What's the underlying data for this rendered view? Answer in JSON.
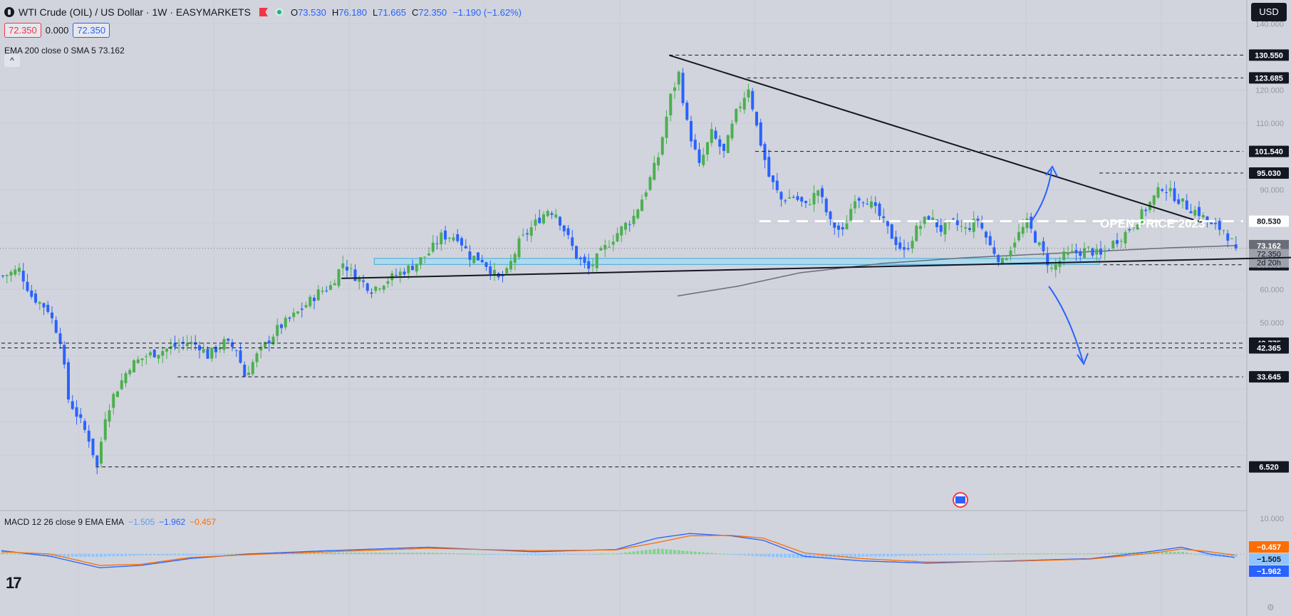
{
  "header": {
    "title": "WTI Crude (OIL) / US Dollar · 1W · EASYMARKETS",
    "ohlc": {
      "o_label": "O",
      "o": "73.530",
      "h_label": "H",
      "h": "76.180",
      "l_label": "L",
      "l": "71.665",
      "c_label": "C",
      "c": "72.350",
      "change": "−1.190 (−1.62%)"
    },
    "sell_price": "72.350",
    "spread": "0.000",
    "buy_price": "72.350",
    "indicator": "EMA 200 close 0 SMA 5  73.162",
    "collapse_icon": "^",
    "currency": "USD"
  },
  "macd": {
    "label": "MACD 12 26 close 9 EMA EMA",
    "v1": "−1.505",
    "v2": "−1.962",
    "v3": "−0.457"
  },
  "colors": {
    "bg": "#d1d4dc",
    "up": "#4caf50",
    "down": "#2962ff",
    "zone": "#a9dcf2",
    "ema": "#6a6d78",
    "macd": "#2962ff",
    "signal": "#ff6d00"
  },
  "chart_data": {
    "type": "candlestick",
    "timeframe": "1W",
    "price_axis_ticks": [
      "140.000",
      "120.000",
      "110.000",
      "90.000",
      "80.000",
      "60.000",
      "50.000"
    ],
    "ylim": [
      -3,
      145
    ],
    "levels": [
      {
        "value": 130.55,
        "label": "130.550"
      },
      {
        "value": 123.685,
        "label": "123.685"
      },
      {
        "value": 101.54,
        "label": "101.540"
      },
      {
        "value": 95.03,
        "label": "95.030"
      },
      {
        "value": 80.53,
        "label": "80.530"
      },
      {
        "value": 67.405,
        "label": "67.405"
      },
      {
        "value": 43.775,
        "label": "43.775"
      },
      {
        "value": 42.365,
        "label": "42.365"
      },
      {
        "value": 33.645,
        "label": "33.645"
      },
      {
        "value": 6.52,
        "label": "6.520"
      }
    ],
    "current": {
      "value": 72.35,
      "label": "72.350",
      "countdown": "2d 20h"
    },
    "ema_value": {
      "value": 73.162,
      "label": "73.162"
    },
    "annotation": "OPEN PRICE 2023",
    "path": [
      [
        0,
        64
      ],
      [
        4,
        66
      ],
      [
        7,
        58
      ],
      [
        11,
        54
      ],
      [
        14,
        45
      ],
      [
        16,
        27
      ],
      [
        19,
        20
      ],
      [
        21,
        15
      ],
      [
        23,
        6.5
      ],
      [
        25,
        22
      ],
      [
        27,
        28
      ],
      [
        31,
        37
      ],
      [
        35,
        40
      ],
      [
        40,
        42
      ],
      [
        45,
        44
      ],
      [
        48,
        43
      ],
      [
        50,
        40
      ],
      [
        54,
        44
      ],
      [
        57,
        42
      ],
      [
        59,
        34
      ],
      [
        62,
        40
      ],
      [
        67,
        48
      ],
      [
        72,
        53
      ],
      [
        77,
        59
      ],
      [
        80,
        61
      ],
      [
        83,
        68
      ],
      [
        86,
        64
      ],
      [
        90,
        60
      ],
      [
        94,
        63
      ],
      [
        100,
        67
      ],
      [
        104,
        71
      ],
      [
        107,
        76
      ],
      [
        111,
        76
      ],
      [
        114,
        70
      ],
      [
        117,
        69
      ],
      [
        121,
        63
      ],
      [
        123,
        65
      ],
      [
        126,
        74
      ],
      [
        130,
        80
      ],
      [
        133,
        84
      ],
      [
        135,
        83
      ],
      [
        137,
        78
      ],
      [
        140,
        70
      ],
      [
        143,
        66
      ],
      [
        146,
        71
      ],
      [
        150,
        77
      ],
      [
        154,
        82
      ],
      [
        157,
        90
      ],
      [
        160,
        100
      ],
      [
        163,
        118
      ],
      [
        165,
        125
      ],
      [
        167,
        110
      ],
      [
        170,
        97
      ],
      [
        173,
        107
      ],
      [
        176,
        101
      ],
      [
        179,
        113
      ],
      [
        182,
        121
      ],
      [
        184,
        109
      ],
      [
        187,
        94
      ],
      [
        190,
        87
      ],
      [
        193,
        88
      ],
      [
        196,
        85
      ],
      [
        199,
        90
      ],
      [
        202,
        80
      ],
      [
        205,
        77
      ],
      [
        208,
        88
      ],
      [
        211,
        87
      ],
      [
        214,
        82
      ],
      [
        217,
        76
      ],
      [
        220,
        71
      ],
      [
        223,
        78
      ],
      [
        226,
        82
      ],
      [
        229,
        78
      ],
      [
        232,
        80
      ],
      [
        235,
        78
      ],
      [
        238,
        81
      ],
      [
        241,
        73
      ],
      [
        244,
        68
      ],
      [
        247,
        75
      ],
      [
        250,
        80
      ],
      [
        253,
        73
      ],
      [
        256,
        66
      ],
      [
        259,
        70
      ],
      [
        262,
        71
      ],
      [
        265,
        72
      ],
      [
        268,
        70
      ],
      [
        271,
        74
      ],
      [
        274,
        77
      ],
      [
        277,
        81
      ],
      [
        280,
        86
      ],
      [
        283,
        91
      ],
      [
        286,
        88
      ],
      [
        289,
        85
      ],
      [
        292,
        83
      ],
      [
        295,
        79
      ],
      [
        298,
        78
      ],
      [
        301,
        72.35
      ]
    ],
    "ema200": [
      [
        165,
        58
      ],
      [
        180,
        61
      ],
      [
        195,
        65
      ],
      [
        215,
        67.8
      ],
      [
        235,
        69.5
      ],
      [
        260,
        71
      ],
      [
        285,
        72.5
      ],
      [
        301,
        73.16
      ]
    ],
    "macd_line": [
      [
        0,
        1.5
      ],
      [
        12,
        -1
      ],
      [
        24,
        -6
      ],
      [
        34,
        -5
      ],
      [
        46,
        -2
      ],
      [
        60,
        0
      ],
      [
        80,
        1.5
      ],
      [
        104,
        3
      ],
      [
        130,
        1
      ],
      [
        150,
        2
      ],
      [
        160,
        7
      ],
      [
        168,
        9
      ],
      [
        178,
        8
      ],
      [
        186,
        6
      ],
      [
        196,
        -1
      ],
      [
        210,
        -3
      ],
      [
        226,
        -4
      ],
      [
        246,
        -3
      ],
      [
        266,
        -2
      ],
      [
        280,
        1
      ],
      [
        288,
        3
      ],
      [
        295,
        0
      ],
      [
        301,
        -1.505
      ]
    ],
    "signal_line": [
      [
        0,
        1
      ],
      [
        12,
        0
      ],
      [
        24,
        -5
      ],
      [
        34,
        -4.5
      ],
      [
        46,
        -1.5
      ],
      [
        60,
        -0.3
      ],
      [
        80,
        1
      ],
      [
        104,
        2.5
      ],
      [
        130,
        1.5
      ],
      [
        150,
        1.8
      ],
      [
        160,
        5
      ],
      [
        168,
        8
      ],
      [
        178,
        8.2
      ],
      [
        186,
        7
      ],
      [
        196,
        0.5
      ],
      [
        210,
        -2
      ],
      [
        226,
        -3.5
      ],
      [
        246,
        -3.2
      ],
      [
        266,
        -2.2
      ],
      [
        280,
        0.2
      ],
      [
        288,
        2.2
      ],
      [
        295,
        1
      ],
      [
        301,
        -0.457
      ]
    ],
    "macd_axis_ticks": [
      "10.000"
    ],
    "macd_ylim": [
      -10,
      10
    ]
  }
}
